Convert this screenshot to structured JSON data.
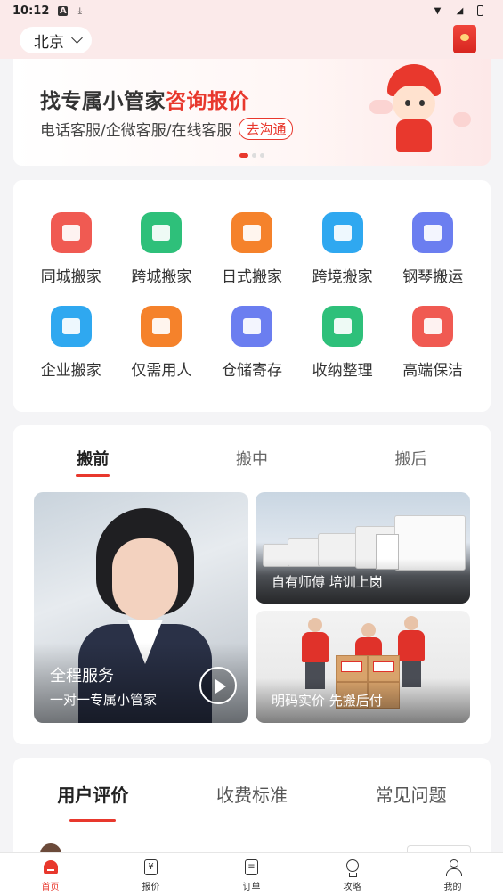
{
  "status_bar": {
    "time": "10:12"
  },
  "header": {
    "city": "北京"
  },
  "banner": {
    "title_part1": "找专属小管家",
    "title_part2": "咨询报价",
    "subtitle": "电话客服/企微客服/在线客服",
    "button": "去沟通"
  },
  "services": [
    {
      "label": "同城搬家",
      "color": "#f05a52",
      "icon": "building-icon"
    },
    {
      "label": "跨城搬家",
      "color": "#2ec07a",
      "icon": "bus-icon"
    },
    {
      "label": "日式搬家",
      "color": "#f5822b",
      "icon": "mover-icon"
    },
    {
      "label": "跨境搬家",
      "color": "#2fa8f0",
      "icon": "ship-icon"
    },
    {
      "label": "钢琴搬运",
      "color": "#6b7ef0",
      "icon": "piano-icon"
    },
    {
      "label": "企业搬家",
      "color": "#2fa8f0",
      "icon": "office-chair-icon"
    },
    {
      "label": "仅需用人",
      "color": "#f5822b",
      "icon": "worker-icon"
    },
    {
      "label": "仓储寄存",
      "color": "#6b7ef0",
      "icon": "warehouse-icon"
    },
    {
      "label": "收纳整理",
      "color": "#2ec07a",
      "icon": "storage-box-icon"
    },
    {
      "label": "高端保洁",
      "color": "#f05a52",
      "icon": "cleaning-bucket-icon"
    }
  ],
  "moving_tabs": [
    "搬前",
    "搬中",
    "搬后"
  ],
  "moving_photos": {
    "main_title": "全程服务",
    "main_subtitle": "一对一专属小管家",
    "trucks_caption": "自有师傅 培训上岗",
    "boxes_caption": "明码实价 先搬后付"
  },
  "review_tabs": [
    "用户评价",
    "收费标准",
    "常见问题"
  ],
  "tab_bar": [
    {
      "label": "首页",
      "icon": "home-icon"
    },
    {
      "label": "报价",
      "icon": "price-icon",
      "glyph": "¥"
    },
    {
      "label": "订单",
      "icon": "order-icon",
      "glyph": "≡"
    },
    {
      "label": "攻略",
      "icon": "bulb-icon"
    },
    {
      "label": "我的",
      "icon": "user-icon"
    }
  ],
  "colors": {
    "accent": "#e8382d"
  }
}
